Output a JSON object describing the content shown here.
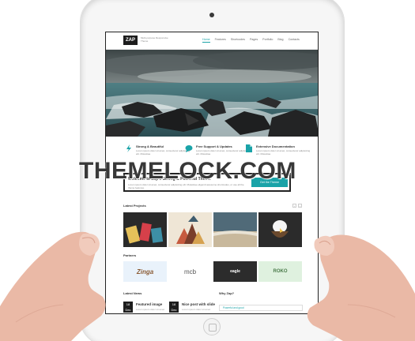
{
  "site": {
    "logo": "ZAP",
    "tagline": "Multi-purpose Responsive Theme",
    "nav": [
      "Home",
      "Features",
      "Shortcodes",
      "Pages",
      "Portfolio",
      "Blog",
      "Contacts"
    ]
  },
  "features": [
    {
      "icon": "bolt-icon",
      "title": "Strong & Beautiful",
      "desc": "Lorem ipsum dolor sit amet, consectetur adipisicing elit. Molestiae"
    },
    {
      "icon": "chat-icon",
      "title": "Free Support & Updates",
      "desc": "Lorem ipsum dolor sit amet, consectetur adipisicing elit. Molestiae"
    },
    {
      "icon": "document-icon",
      "title": "Extensive Documentation",
      "desc": "Lorem ipsum dolor sit amet, consectetur adipisicing elit. Molestiae"
    }
  ],
  "promo": {
    "title": "Welcome to Zap's Strong & Powerful Theme",
    "text": "Lorem ipsum dolor sit amet, consectetur adipisicing elit. Molestiae eligendi awesome shortcodes, or use all the theme features.",
    "button": "Get the Theme"
  },
  "watermark": "THEMELOCK.COM",
  "sections": {
    "projects": "Latest Projects",
    "partners": "Partners",
    "news": "Latest News",
    "why": "Why Zap?"
  },
  "partners": [
    "Zinga",
    "mcb",
    "eagle",
    "ROKO"
  ],
  "news": [
    {
      "day": "18",
      "month": "Dec",
      "title": "Featured image",
      "meta": "Lorem ipsum dolor sit amet"
    },
    {
      "day": "18",
      "month": "Dec",
      "title": "Nice post with slide",
      "meta": "Lorem ipsum dolor sit amet"
    }
  ],
  "why_tab": "Powerful and good",
  "colors": {
    "accent": "#1aa3a8",
    "dark": "#1d1d1d"
  }
}
